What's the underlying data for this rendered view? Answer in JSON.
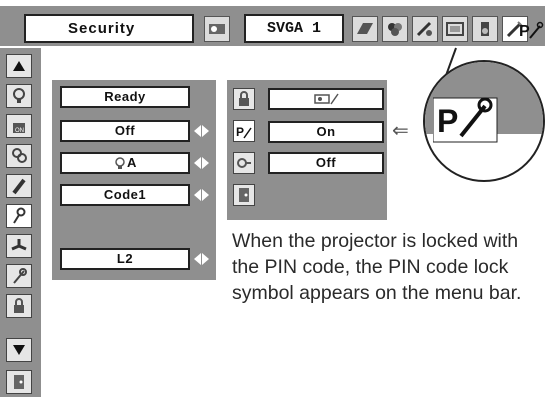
{
  "menubar": {
    "title": "Security",
    "resolution": "SVGA 1",
    "icons": [
      "projector-icon",
      "monitor-icon",
      "color-icon",
      "image-adjust-icon",
      "screen-icon",
      "sound-icon",
      "setting-icon",
      "pin-lock-icon"
    ]
  },
  "sidebar": {
    "icons": [
      "arrow-up-icon",
      "lamp-icon",
      "key-lock-icon",
      "pin-code-lamp-icon",
      "pen-icon",
      "pin-key-icon",
      "fan-off-icon",
      "key-settings-icon",
      "security-key-icon",
      "arrow-down-icon",
      "exit-icon"
    ]
  },
  "left_panel": {
    "values": [
      "Ready",
      "Off",
      "A",
      "Code1",
      "L2"
    ]
  },
  "right_panel": {
    "values": [
      "",
      "On",
      "Off"
    ]
  },
  "caption": "When the projector is locked with the PIN code, the PIN code lock symbol appears on the menu bar.",
  "colors": {
    "panel": "#8f8f8f",
    "field": "#ffffff",
    "border": "#222222",
    "text": "#2a2a2a"
  }
}
